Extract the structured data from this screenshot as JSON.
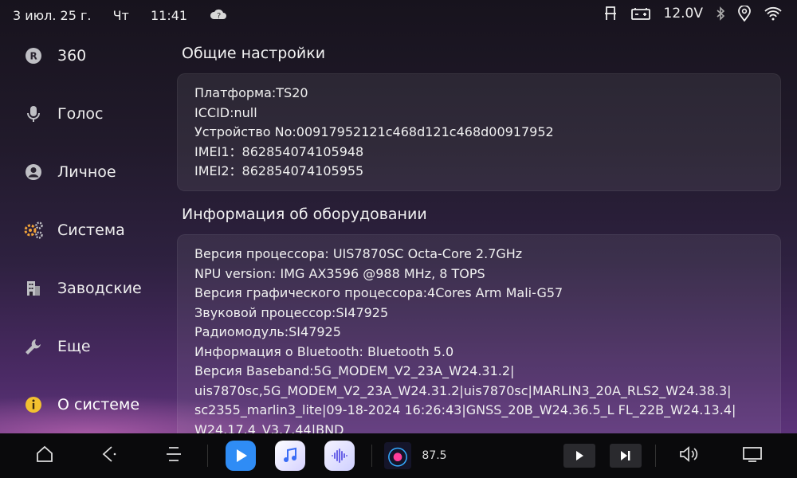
{
  "status": {
    "date": "3 июл. 25 г.",
    "weekday": "Чт",
    "time": "11:41",
    "voltage": "12.0V"
  },
  "sidebar": {
    "items": [
      {
        "label": "360",
        "icon": "r-badge-icon"
      },
      {
        "label": "Голос",
        "icon": "microphone-icon"
      },
      {
        "label": "Личное",
        "icon": "person-icon"
      },
      {
        "label": "Система",
        "icon": "gears-icon"
      },
      {
        "label": "Заводские",
        "icon": "building-icon"
      },
      {
        "label": "Еще",
        "icon": "wrench-icon"
      },
      {
        "label": "О системе",
        "icon": "info-icon"
      }
    ],
    "active_index": 6
  },
  "general": {
    "title": "Общие настройки",
    "rows": [
      "Платформа:TS20",
      "ICCID:null",
      "Устройство No:00917952121c468d121c468d00917952",
      "IMEI1：862854074105948",
      "IMEI2：862854074105955"
    ]
  },
  "hardware": {
    "title": "Информация об оборудовании",
    "rows": [
      "Версия процессора: UIS7870SC Octa-Core 2.7GHz",
      "NPU version: IMG AX3596 @988 MHz, 8 TOPS",
      "Версия графического процессора:4Cores Arm Mali-G57",
      "Звуковой процессор:SI47925",
      "Радиомодуль:SI47925",
      "Информация о Bluetooth: Bluetooth 5.0",
      "Версия Baseband:5G_MODEM_V2_23A_W24.31.2|",
      "uis7870sc,5G_MODEM_V2_23A_W24.31.2|uis7870sc|MARLIN3_20A_RLS2_W24.38.3|",
      "sc2355_marlin3_lite|09-18-2024 16:26:43|GNSS_20B_W24.36.5_L FL_22B_W24.13.4|",
      "W24.17.4_V3.7.44|BND"
    ]
  },
  "navbar": {
    "radio_freq": "87.5"
  },
  "colors": {
    "accent_blue": "#2f8cf5",
    "music_gradient": "#e9e4ff",
    "info_yellow": "#f2c130"
  }
}
